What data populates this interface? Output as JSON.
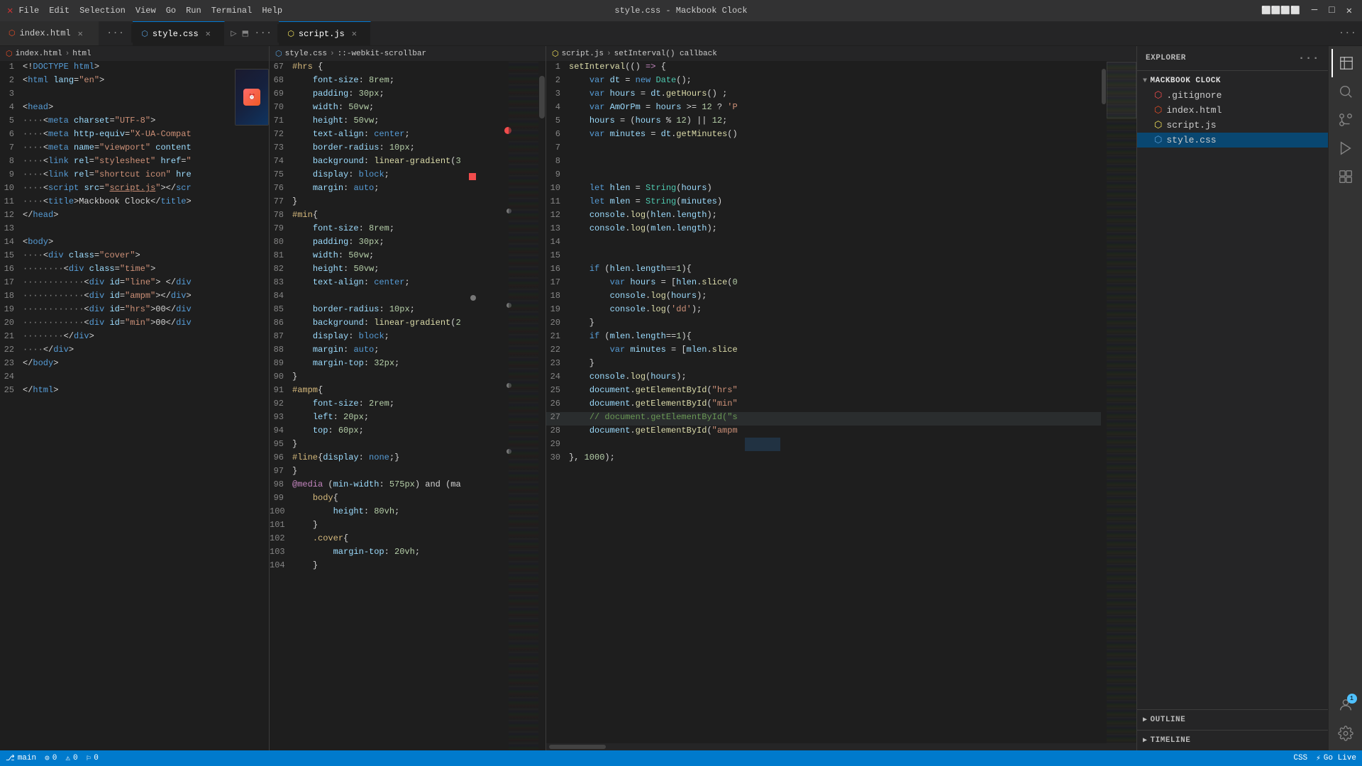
{
  "titleBar": {
    "logo": "✕",
    "menus": [
      "File",
      "Edit",
      "Selection",
      "View",
      "Go",
      "Run",
      "Terminal",
      "Help"
    ],
    "title": "style.css - Mackbook Clock",
    "controls": [
      "─",
      "□",
      "✕"
    ]
  },
  "tabBar": {
    "leftTabs": [
      {
        "label": "index.html",
        "icon": "html",
        "active": false,
        "closeable": true
      },
      {
        "label": "···",
        "isMore": true
      }
    ],
    "middleTabs": [
      {
        "label": "style.css",
        "icon": "css",
        "active": true,
        "closeable": true
      }
    ],
    "rightTabs": [
      {
        "label": "script.js",
        "icon": "js",
        "active": true,
        "closeable": true
      }
    ]
  },
  "leftPanel": {
    "breadcrumb": [
      "index.html",
      "html"
    ],
    "lines": [
      {
        "num": 1,
        "content": "<!DOCTYPE html>"
      },
      {
        "num": 2,
        "content": "<html lang=\"en\">"
      },
      {
        "num": 3,
        "content": ""
      },
      {
        "num": 4,
        "content": "<head>"
      },
      {
        "num": 5,
        "content": "    <meta charset=\"UTF-8\">"
      },
      {
        "num": 6,
        "content": "    <meta http-equiv=\"X-UA-Compat"
      },
      {
        "num": 7,
        "content": "    <meta name=\"viewport\" content"
      },
      {
        "num": 8,
        "content": "    <link rel=\"stylesheet\" href=\""
      },
      {
        "num": 9,
        "content": "    <link rel=\"shortcut icon\" hre"
      },
      {
        "num": 10,
        "content": "    <script src=\"script.js\"></scr"
      },
      {
        "num": 11,
        "content": "    <title>Mackbook Clock</title>"
      },
      {
        "num": 12,
        "content": "</head>"
      },
      {
        "num": 13,
        "content": ""
      },
      {
        "num": 14,
        "content": "<body>"
      },
      {
        "num": 15,
        "content": "    <div class=\"cover\">"
      },
      {
        "num": 16,
        "content": "        <div class=\"time\">"
      },
      {
        "num": 17,
        "content": "            <div id=\"line\"> </div"
      },
      {
        "num": 18,
        "content": "            <div id=\"ampm\"></div>"
      },
      {
        "num": 19,
        "content": "            <div id=\"hrs\">00</div"
      },
      {
        "num": 20,
        "content": "            <div id=\"min\">00</div"
      },
      {
        "num": 21,
        "content": "        </div>"
      },
      {
        "num": 22,
        "content": "    </div>"
      },
      {
        "num": 23,
        "content": "</body>"
      },
      {
        "num": 24,
        "content": ""
      },
      {
        "num": 25,
        "content": "</html>"
      }
    ]
  },
  "middlePanel": {
    "breadcrumb": "style.css > ::-webkit-scrollbar",
    "lines": [
      {
        "num": 67,
        "content": "#hrs {"
      },
      {
        "num": 68,
        "content": "    font-size: 8rem;"
      },
      {
        "num": 69,
        "content": "    padding: 30px;"
      },
      {
        "num": 70,
        "content": "    width: 50vw;"
      },
      {
        "num": 71,
        "content": "    height: 50vw;"
      },
      {
        "num": 72,
        "content": "    text-align: center;"
      },
      {
        "num": 73,
        "content": "    border-radius: 10px;"
      },
      {
        "num": 74,
        "content": "    background: linear-gradient(3"
      },
      {
        "num": 75,
        "content": "    display: block;"
      },
      {
        "num": 76,
        "content": "    margin: auto;"
      },
      {
        "num": 77,
        "content": "}"
      },
      {
        "num": 78,
        "content": "#min{"
      },
      {
        "num": 79,
        "content": "    font-size: 8rem;"
      },
      {
        "num": 80,
        "content": "    padding: 30px;"
      },
      {
        "num": 81,
        "content": "    width: 50vw;"
      },
      {
        "num": 82,
        "content": "    height: 50vw;"
      },
      {
        "num": 83,
        "content": "    text-align: center;"
      },
      {
        "num": 84,
        "content": ""
      },
      {
        "num": 85,
        "content": "    border-radius: 10px;"
      },
      {
        "num": 86,
        "content": "    background: linear-gradient(2"
      },
      {
        "num": 87,
        "content": "    display: block;"
      },
      {
        "num": 88,
        "content": "    margin: auto;"
      },
      {
        "num": 89,
        "content": "    margin-top: 32px;"
      },
      {
        "num": 90,
        "content": "}"
      },
      {
        "num": 91,
        "content": "#ampm{"
      },
      {
        "num": 92,
        "content": "    font-size: 2rem;"
      },
      {
        "num": 93,
        "content": "    left: 20px;"
      },
      {
        "num": 94,
        "content": "    top: 60px;"
      },
      {
        "num": 95,
        "content": "}"
      },
      {
        "num": 96,
        "content": "#line{display: none;}"
      },
      {
        "num": 97,
        "content": "}"
      },
      {
        "num": 98,
        "content": "@media (min-width: 575px) and (ma"
      },
      {
        "num": 99,
        "content": "    body{"
      },
      {
        "num": 100,
        "content": "        height: 80vh;"
      },
      {
        "num": 101,
        "content": "    }"
      },
      {
        "num": 102,
        "content": "    .cover{"
      },
      {
        "num": 103,
        "content": "        margin-top: 20vh;"
      },
      {
        "num": 104,
        "content": "    }"
      }
    ]
  },
  "rightPanel": {
    "breadcrumb": [
      "script.js",
      "setInterval() callback"
    ],
    "lines": [
      {
        "num": 1,
        "content": "setInterval(() => {"
      },
      {
        "num": 2,
        "content": "    var dt = new Date();"
      },
      {
        "num": 3,
        "content": "    var hours = dt.getHours() ;"
      },
      {
        "num": 4,
        "content": "    var AmOrPm = hours >= 12 ? 'P"
      },
      {
        "num": 5,
        "content": "    hours = (hours % 12) || 12;"
      },
      {
        "num": 6,
        "content": "    var minutes = dt.getMinutes()"
      },
      {
        "num": 7,
        "content": ""
      },
      {
        "num": 8,
        "content": ""
      },
      {
        "num": 9,
        "content": ""
      },
      {
        "num": 10,
        "content": "    let hlen = String(hours)"
      },
      {
        "num": 11,
        "content": "    let mlen = String(minutes)"
      },
      {
        "num": 12,
        "content": "    console.log(hlen.length);"
      },
      {
        "num": 13,
        "content": "    console.log(mlen.length);"
      },
      {
        "num": 14,
        "content": ""
      },
      {
        "num": 15,
        "content": ""
      },
      {
        "num": 16,
        "content": "    if (hlen.length==1){"
      },
      {
        "num": 17,
        "content": "        var hours = [hlen.slice(0"
      },
      {
        "num": 18,
        "content": "        console.log(hours);"
      },
      {
        "num": 19,
        "content": "        console.log('dd');"
      },
      {
        "num": 20,
        "content": "    }"
      },
      {
        "num": 21,
        "content": "    if (mlen.length==1){"
      },
      {
        "num": 22,
        "content": "        var minutes = [mlen.slice"
      },
      {
        "num": 23,
        "content": "    }"
      },
      {
        "num": 24,
        "content": "    console.log(hours);"
      },
      {
        "num": 25,
        "content": "    document.getElementById(\"hrs\""
      },
      {
        "num": 26,
        "content": "    document.getElementById(\"min\""
      },
      {
        "num": 27,
        "content": "    // document.getElementById(\"s"
      },
      {
        "num": 28,
        "content": "    document.getElementById(\"ampm"
      },
      {
        "num": 29,
        "content": ""
      },
      {
        "num": 30,
        "content": "}, 1000);"
      }
    ]
  },
  "explorer": {
    "header": "EXPLORER",
    "sectionTitle": "MACKBOOK CLOCK",
    "files": [
      {
        "name": ".gitignore",
        "icon": "git"
      },
      {
        "name": "index.html",
        "icon": "html"
      },
      {
        "name": "script.js",
        "icon": "js"
      },
      {
        "name": "style.css",
        "icon": "css",
        "active": true
      }
    ],
    "outline": "OUTLINE",
    "timeline": "TIMELINE"
  },
  "statusBar": {
    "left": [
      "⎇ main",
      "⊙ 0",
      "⚠ 0",
      "⚐ 0"
    ],
    "right": [
      "CSS",
      "Go Live"
    ]
  }
}
